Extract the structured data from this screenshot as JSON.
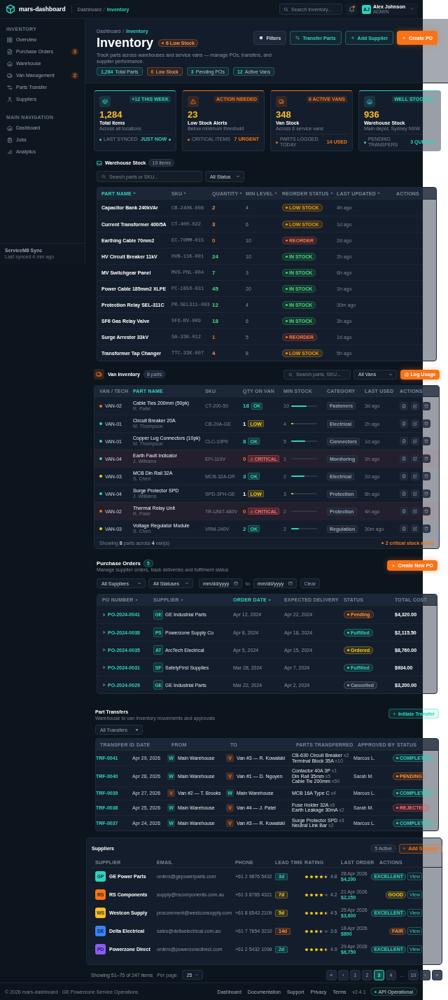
{
  "header": {
    "logo": "mars-dashboard",
    "breadcrumb": {
      "separator": "/",
      "items": [
        {
          "label": "Dashboard",
          "selected": false
        },
        {
          "label": "Inventory",
          "selected": true
        }
      ]
    },
    "search": {
      "placeholder": "Search inventory..."
    },
    "notifications": {
      "unread": true
    },
    "user": {
      "initials": "AJ",
      "name": "Alex Johnson",
      "role": "ADMIN"
    }
  },
  "sidebar": {
    "sections": [
      {
        "title": "INVENTORY",
        "items": [
          {
            "label": "Overview",
            "selected": false
          },
          {
            "label": "Purchase Orders",
            "badge": "3",
            "selected": false
          },
          {
            "label": "Warehouse",
            "selected": false
          },
          {
            "label": "Van Management",
            "badge": "2",
            "selected": false
          },
          {
            "label": "Parts Transfer",
            "selected": false
          },
          {
            "label": "Suppliers",
            "selected": false
          }
        ]
      },
      {
        "title": "MAIN NAVIGATION",
        "items": [
          {
            "label": "Dashboard",
            "selected": false
          },
          {
            "label": "Jobs",
            "selected": false
          },
          {
            "label": "Analytics",
            "selected": false
          }
        ]
      }
    ],
    "sync": {
      "title": "ServiceM8 Sync",
      "status": "Last synced 4 min ago"
    }
  },
  "page_header": {
    "breadcrumb": {
      "separator": "/",
      "items": [
        {
          "label": "Dashboard",
          "selected": false
        },
        {
          "label": "Inventory",
          "selected": true
        }
      ]
    },
    "title": "Inventory",
    "alert": "6 Low Stock",
    "description": "Track parts across warehouses and service vans — manage POs, transfers, and supplier performance.",
    "chips": [
      {
        "value": "1,284",
        "label": "Total Parts",
        "kind": "info"
      },
      {
        "value": "6",
        "label": "Low Stock",
        "kind": "warning"
      },
      {
        "value": "3",
        "label": "Pending POs",
        "kind": "info"
      },
      {
        "value": "12",
        "label": "Active Vans",
        "kind": "info"
      }
    ],
    "actions": [
      {
        "label": "Filters",
        "kind": "neutral"
      },
      {
        "label": "Transfer Parts",
        "kind": "outline"
      },
      {
        "label": "Add Supplier",
        "kind": "outline"
      },
      {
        "label": "Create PO",
        "kind": "primary"
      }
    ]
  },
  "stats": [
    {
      "value": "1,284",
      "label": "Total Items",
      "subtitle": "Across all locations",
      "badge": "+12 THIS WEEK",
      "footer_label": "LAST SYNCED",
      "footer_value": "JUST NOW",
      "live": true,
      "color": "#2dd4bf"
    },
    {
      "value": "23",
      "label": "Low Stock Alerts",
      "subtitle": "Below minimum threshold",
      "badge": "ACTION NEEDED",
      "footer_label": "CRITICAL ITEMS",
      "footer_value": "7 URGENT",
      "live": false,
      "color": "#f97316"
    },
    {
      "value": "348",
      "label": "Van Stock",
      "subtitle": "Across 6 service vans",
      "badge": "6 ACTIVE VANS",
      "footer_label": "PARTS LOGGED TODAY",
      "footer_value": "14 USED",
      "live": false,
      "color": "#f97316"
    },
    {
      "value": "936",
      "label": "Warehouse Stock",
      "subtitle": "Main depot, Sydney NSW",
      "badge": "WELL STOCKED",
      "footer_label": "PENDING TRANSFERS",
      "footer_value": "3 QUEUED",
      "live": false,
      "color": "#2dd4bf"
    }
  ],
  "warehouse": {
    "title": "Warehouse Stock",
    "count": "10 items",
    "search": {
      "placeholder": "Search parts or SKU..."
    },
    "filter": "All Status",
    "columns": [
      {
        "label": "PART NAME",
        "sorted": true
      },
      {
        "label": "SKU",
        "sorted": false
      },
      {
        "label": "QUANTITY",
        "sorted": false
      },
      {
        "label": "MIN LEVEL",
        "sorted": false
      },
      {
        "label": "REORDER STATUS",
        "sorted": false
      },
      {
        "label": "LAST UPDATED",
        "sorted": false
      },
      {
        "label": "ACTIONS"
      }
    ],
    "rows": [
      {
        "name": "Capacitor Bank 240kVAr",
        "sku": "CB-240K-008",
        "quantity": "2",
        "min_level": "4",
        "status": {
          "label": "LOW STOCK",
          "kind": "low"
        },
        "updated": "4h ago"
      },
      {
        "name": "Current Transformer 400/5A",
        "sku": "CT-400-022",
        "quantity": "3",
        "min_level": "6",
        "status": {
          "label": "LOW STOCK",
          "kind": "low"
        },
        "updated": "1d ago"
      },
      {
        "name": "Earthing Cable 70mm2",
        "sku": "EC-70MM-015",
        "quantity": "0",
        "min_level": "10",
        "status": {
          "label": "REORDER",
          "kind": "reorder"
        },
        "updated": "2d ago"
      },
      {
        "name": "HV Circuit Breaker 11kV",
        "sku": "HVB-11K-001",
        "quantity": "24",
        "min_level": "10",
        "status": {
          "label": "IN STOCK",
          "kind": "in_stock"
        },
        "updated": "2h ago"
      },
      {
        "name": "MV Switchgear Panel",
        "sku": "MVS-PNL-004",
        "quantity": "7",
        "min_level": "3",
        "status": {
          "label": "IN STOCK",
          "kind": "in_stock"
        },
        "updated": "6h ago"
      },
      {
        "name": "Power Cable 185mm2 XLPE",
        "sku": "PC-185X-031",
        "quantity": "45",
        "min_level": "20",
        "status": {
          "label": "IN STOCK",
          "kind": "in_stock"
        },
        "updated": "1h ago"
      },
      {
        "name": "Protection Relay SEL-311C",
        "sku": "PR-SEL311-003",
        "quantity": "12",
        "min_level": "4",
        "status": {
          "label": "IN STOCK",
          "kind": "in_stock"
        },
        "updated": "30m ago"
      },
      {
        "name": "SF6 Gas Relay Valve",
        "sku": "SF6-RV-009",
        "quantity": "18",
        "min_level": "6",
        "status": {
          "label": "IN STOCK",
          "kind": "in_stock"
        },
        "updated": "3h ago"
      },
      {
        "name": "Surge Arrester 33kV",
        "sku": "SA-33K-012",
        "quantity": "1",
        "min_level": "5",
        "status": {
          "label": "REORDER",
          "kind": "reorder"
        },
        "updated": "1d ago"
      },
      {
        "name": "Transformer Tap Changer",
        "sku": "TTC-33K-007",
        "quantity": "4",
        "min_level": "8",
        "status": {
          "label": "LOW STOCK",
          "kind": "low"
        },
        "updated": "5h ago"
      }
    ]
  },
  "van": {
    "title": "Van Inventory",
    "count": "8 parts",
    "search": {
      "placeholder": "Search parts, SKU..."
    },
    "filter": "All Vans",
    "action": "Log Usage",
    "columns": [
      {
        "label": "VAN / TECH",
        "sorted": false
      },
      {
        "label": "PART NAME",
        "sorted": true
      },
      {
        "label": "SKU",
        "sorted": false
      },
      {
        "label": "QTY ON VAN",
        "sorted": false
      },
      {
        "label": "MIN STOCK",
        "sorted": false
      },
      {
        "label": "CATEGORY",
        "sorted": false
      },
      {
        "label": "LAST USED",
        "sorted": false
      },
      {
        "label": "ACTIONS"
      }
    ],
    "rows": [
      {
        "van": "VAN-02",
        "color": "#f97316",
        "part": "Cable Ties 200mm (50pk)",
        "tech": "R. Patel",
        "sku": "CT-200-50",
        "qty": "18",
        "stock": {
          "label": "OK",
          "kind": "ok"
        },
        "min": "10",
        "level": 0.6,
        "category": "Fasteners",
        "last_used": "3d ago"
      },
      {
        "van": "VAN-01",
        "color": "#2dd4bf",
        "part": "Circuit Breaker 20A",
        "tech": "M. Thompson",
        "sku": "CB-20A-GE",
        "qty": "1",
        "stock": {
          "label": "LOW",
          "kind": "low"
        },
        "min": "4",
        "level": 0.08,
        "category": "Electrical",
        "last_used": "2h ago"
      },
      {
        "van": "VAN-01",
        "color": "#2dd4bf",
        "part": "Copper Lug Connectors (10pk)",
        "tech": "M. Thompson",
        "sku": "CLC-10PK",
        "qty": "8",
        "stock": {
          "label": "OK",
          "kind": "ok"
        },
        "min": "5",
        "level": 0.55,
        "category": "Connectors",
        "last_used": "1d ago"
      },
      {
        "van": "VAN-04",
        "color": "#2dd4bf",
        "part": "Earth Fault Indicator",
        "tech": "J. Williams",
        "sku": "EFI-110V",
        "qty": "0",
        "stock": {
          "label": "CRITICAL",
          "kind": "critical"
        },
        "min": "1",
        "level": 0,
        "category": "Monitoring",
        "last_used": "1h ago"
      },
      {
        "van": "VAN-03",
        "color": "#facc15",
        "part": "MCB Din Rail 32A",
        "tech": "S. Chen",
        "sku": "MCB-32A-DR",
        "qty": "3",
        "stock": {
          "label": "OK",
          "kind": "ok"
        },
        "min": "2",
        "level": 0.5,
        "category": "Electrical",
        "last_used": "2d ago"
      },
      {
        "van": "VAN-04",
        "color": "#2dd4bf",
        "part": "Surge Protector SPD",
        "tech": "J. Williams",
        "sku": "SPD-3PH-GE",
        "qty": "1",
        "stock": {
          "label": "LOW",
          "kind": "low"
        },
        "min": "3",
        "level": 0.08,
        "category": "Protection",
        "last_used": "6h ago"
      },
      {
        "van": "VAN-02",
        "color": "#f97316",
        "part": "Thermal Relay Unit",
        "tech": "R. Patel",
        "sku": "TR-UNIT-480V",
        "qty": "0",
        "stock": {
          "label": "CRITICAL",
          "kind": "critical"
        },
        "min": "2",
        "level": 0,
        "category": "Protection",
        "last_used": "4h ago"
      },
      {
        "van": "VAN-03",
        "color": "#facc15",
        "part": "Voltage Regulator Module",
        "tech": "S. Chen",
        "sku": "VRM-240V",
        "qty": "2",
        "stock": {
          "label": "OK",
          "kind": "ok"
        },
        "min": "2",
        "level": 0.3,
        "category": "Regulation",
        "last_used": "30m ago"
      }
    ],
    "footer": {
      "summary": "Showing **8** parts across **4** van(s)",
      "alert": "2 critical stock alerts"
    }
  },
  "purchase_orders": {
    "title": "Purchase Orders",
    "count": "5",
    "subtitle": "Manage supplier orders, track deliveries and fulfilment status",
    "action": "Create New PO",
    "filters": {
      "supplier": "All Suppliers",
      "status": "All Statuses",
      "date_from": {
        "placeholder": "mm/dd/yyyy"
      },
      "separator": "to",
      "date_to": {
        "placeholder": "mm/dd/yyyy"
      },
      "clear": "Clear"
    },
    "columns": [
      {
        "label": "PO NUMBER",
        "sorted": false
      },
      {
        "label": "SUPPLIER",
        "sorted": false
      },
      {
        "label": "ORDER DATE",
        "sorted": true
      },
      {
        "label": "EXPECTED DELIVERY"
      },
      {
        "label": "STATUS"
      },
      {
        "label": "TOTAL COST"
      }
    ],
    "rows": [
      {
        "number": "PO-2024-0041",
        "expanded": false,
        "supplier_code": "GE",
        "supplier": "GE Industrial Parts",
        "ordered": "Apr 12, 2024",
        "expected": "Apr 22, 2024",
        "status": {
          "label": "Pending",
          "kind": "pending"
        },
        "total": "$4,320.00"
      },
      {
        "number": "PO-2024-0038",
        "expanded": false,
        "supplier_code": "PS",
        "supplier": "Powerzone Supply Co",
        "ordered": "Apr 8, 2024",
        "expected": "Apr 18, 2024",
        "status": {
          "label": "Fulfilled",
          "kind": "fulfilled"
        },
        "total": "$2,115.50"
      },
      {
        "number": "PO-2024-0035",
        "expanded": false,
        "supplier_code": "AT",
        "supplier": "ArcTech Electrical",
        "ordered": "Apr 5, 2024",
        "expected": "Apr 15, 2024",
        "status": {
          "label": "Ordered",
          "kind": "ordered"
        },
        "total": "$8,760.00"
      },
      {
        "number": "PO-2024-0031",
        "expanded": false,
        "supplier_code": "SF",
        "supplier": "SafetyFirst Supplies",
        "ordered": "Mar 28, 2024",
        "expected": "Apr 7, 2024",
        "status": {
          "label": "Fulfilled",
          "kind": "fulfilled"
        },
        "total": "$934.00"
      },
      {
        "number": "PO-2024-0029",
        "expanded": false,
        "supplier_code": "GE",
        "supplier": "GE Industrial Parts",
        "ordered": "Mar 22, 2024",
        "expected": "Apr 2, 2024",
        "status": {
          "label": "Cancelled",
          "kind": "cancelled"
        },
        "total": "$3,200.00"
      }
    ]
  },
  "transfers": {
    "title": "Part Transfers",
    "subtitle": "Warehouse to van inventory movements and approvals",
    "action": "Initiate Transfer",
    "filter": "All Transfers",
    "columns": [
      "TRANSFER ID",
      "DATE",
      "FROM",
      "TO",
      "PARTS TRANSFERRED",
      "APPROVED BY",
      "STATUS"
    ],
    "rows": [
      {
        "id": "TRF-0041",
        "date": "Apr 29, 2026",
        "from": {
          "kind": "warehouse",
          "code": "W",
          "label": "Main Warehouse"
        },
        "to": {
          "kind": "van",
          "code": "V",
          "label": "Van #3 — R. Kowalski"
        },
        "parts": [
          {
            "name": "CB-630 Circuit Breaker",
            "qty": "x2"
          },
          {
            "name": "Terminal Block 35A",
            "qty": "x10"
          }
        ],
        "approved_by": "Marcus L.",
        "status": {
          "label": "COMPLETED",
          "kind": "completed"
        }
      },
      {
        "id": "TRF-0040",
        "date": "Apr 28, 2026",
        "from": {
          "kind": "warehouse",
          "code": "W",
          "label": "Main Warehouse"
        },
        "to": {
          "kind": "van",
          "code": "V",
          "label": "Van #1 — D. Nguyen"
        },
        "parts": [
          {
            "name": "Contactor 40A 3P",
            "qty": "x1"
          },
          {
            "name": "Din Rail 35mm",
            "qty": "x5"
          },
          {
            "name": "Cable Tie 200mm",
            "qty": "x50"
          }
        ],
        "approved_by": "Sarah M.",
        "status": {
          "label": "PENDING",
          "kind": "pending"
        }
      },
      {
        "id": "TRF-0039",
        "date": "Apr 27, 2026",
        "from": {
          "kind": "van",
          "code": "V",
          "label": "Van #2 — T. Brooks"
        },
        "to": {
          "kind": "warehouse",
          "code": "W",
          "label": "Main Warehouse"
        },
        "parts": [
          {
            "name": "MCB 16A Type C",
            "qty": "x4"
          }
        ],
        "approved_by": "Marcus L.",
        "status": {
          "label": "COMPLETED",
          "kind": "completed"
        }
      },
      {
        "id": "TRF-0038",
        "date": "Apr 25, 2026",
        "from": {
          "kind": "warehouse",
          "code": "W",
          "label": "Main Warehouse"
        },
        "to": {
          "kind": "van",
          "code": "V",
          "label": "Van #4 — J. Patel"
        },
        "parts": [
          {
            "name": "Fuse Holder 32A",
            "qty": "x6"
          },
          {
            "name": "Earth Leakage 30mA",
            "qty": "x2"
          }
        ],
        "approved_by": "Sarah M.",
        "status": {
          "label": "REJECTED",
          "kind": "rejected"
        }
      },
      {
        "id": "TRF-0037",
        "date": "Apr 24, 2026",
        "from": {
          "kind": "warehouse",
          "code": "W",
          "label": "Main Warehouse"
        },
        "to": {
          "kind": "van",
          "code": "V",
          "label": "Van #3 — R. Kowalski"
        },
        "parts": [
          {
            "name": "Surge Protector SPD",
            "qty": "x3"
          },
          {
            "name": "Neutral Link Bar",
            "qty": "x2"
          }
        ],
        "approved_by": "Marcus L.",
        "status": {
          "label": "COMPLETED",
          "kind": "completed"
        }
      }
    ]
  },
  "suppliers": {
    "title": "Suppliers",
    "active": "5 Active",
    "action": "Add Supplier",
    "columns": [
      "SUPPLIER",
      "EMAIL",
      "PHONE",
      "LEAD TIME",
      "RATING",
      "LAST ORDER",
      "ACTIONS"
    ],
    "rows": [
      {
        "initials": "GP",
        "color": "#2dd4bf",
        "name": "GE Power Parts",
        "email": "orders@gepowerparts.com",
        "phone": "+61 2 9876 5432",
        "lead_time": {
          "label": "3d",
          "kind": "fast"
        },
        "stars": 4.5,
        "rating": "4.8",
        "last_order": "28 Apr 2026",
        "amount": "$4,290",
        "status": {
          "label": "EXCELLENT",
          "kind": "excellent"
        },
        "view": "View"
      },
      {
        "initials": "RS",
        "color": "#f97316",
        "name": "RS Components",
        "email": "supply@rscomponents.com.au",
        "phone": "+61 3 8765 4321",
        "lead_time": {
          "label": "7d",
          "kind": "medium"
        },
        "stars": 4,
        "rating": "4.2",
        "last_order": "21 Apr 2026",
        "amount": "$2,150",
        "status": {
          "label": "GOOD",
          "kind": "good"
        },
        "view": "View"
      },
      {
        "initials": "WS",
        "color": "#fbbf24",
        "name": "Westcon Supply",
        "email": "procurement@westconsupply.com",
        "phone": "+61 8 6543 2109",
        "lead_time": {
          "label": "5d",
          "kind": "medium"
        },
        "stars": 4.5,
        "rating": "4.5",
        "last_order": "25 Apr 2026",
        "amount": "$3,600",
        "status": {
          "label": "EXCELLENT",
          "kind": "excellent"
        },
        "view": "View"
      },
      {
        "initials": "DE",
        "color": "#3b82f6",
        "name": "Delta Electrical",
        "email": "sales@deltaelectrical.com.au",
        "phone": "+61 7 7654 3210",
        "lead_time": {
          "label": "14d",
          "kind": "slow"
        },
        "stars": 3.5,
        "rating": "3.6",
        "last_order": "18 Apr 2026",
        "amount": "$890",
        "status": {
          "label": "FAIR",
          "kind": "fair"
        },
        "view": "View"
      },
      {
        "initials": "PD",
        "color": "#8b5cf6",
        "name": "Powerzone Direct",
        "email": "orders@powerzonedirect.com",
        "phone": "+61 2 5432 1098",
        "lead_time": {
          "label": "2d",
          "kind": "fast"
        },
        "stars": 4.5,
        "rating": "4.9",
        "last_order": "29 Apr 2026",
        "amount": "$6,750",
        "status": {
          "label": "EXCELLENT",
          "kind": "excellent"
        },
        "view": "View"
      }
    ]
  },
  "pagination": {
    "summary": "Showing 51–75 of 247 items",
    "per_page_label": "Per page:",
    "per_page": "25",
    "pages": [
      {
        "label": "«",
        "kind": "page",
        "selected": false
      },
      {
        "label": "‹",
        "kind": "page",
        "selected": false
      },
      {
        "label": "1",
        "kind": "page",
        "selected": false
      },
      {
        "label": "2",
        "kind": "page",
        "selected": false
      },
      {
        "label": "3",
        "kind": "page",
        "selected": true
      },
      {
        "label": "4",
        "kind": "page",
        "selected": false
      },
      {
        "label": "…",
        "kind": "gap"
      },
      {
        "label": "10",
        "kind": "page",
        "selected": false
      },
      {
        "label": "›",
        "kind": "page",
        "selected": false
      },
      {
        "label": "»",
        "kind": "page",
        "selected": false
      }
    ]
  },
  "footer": {
    "copyright": "© 2026 mars-dashboard · GE Powerzone Service Operations",
    "links": [
      "Dashboard",
      "Documentation",
      "Support",
      "Privacy",
      "Terms"
    ],
    "version": "v2.4.1",
    "status": "API Operational"
  }
}
